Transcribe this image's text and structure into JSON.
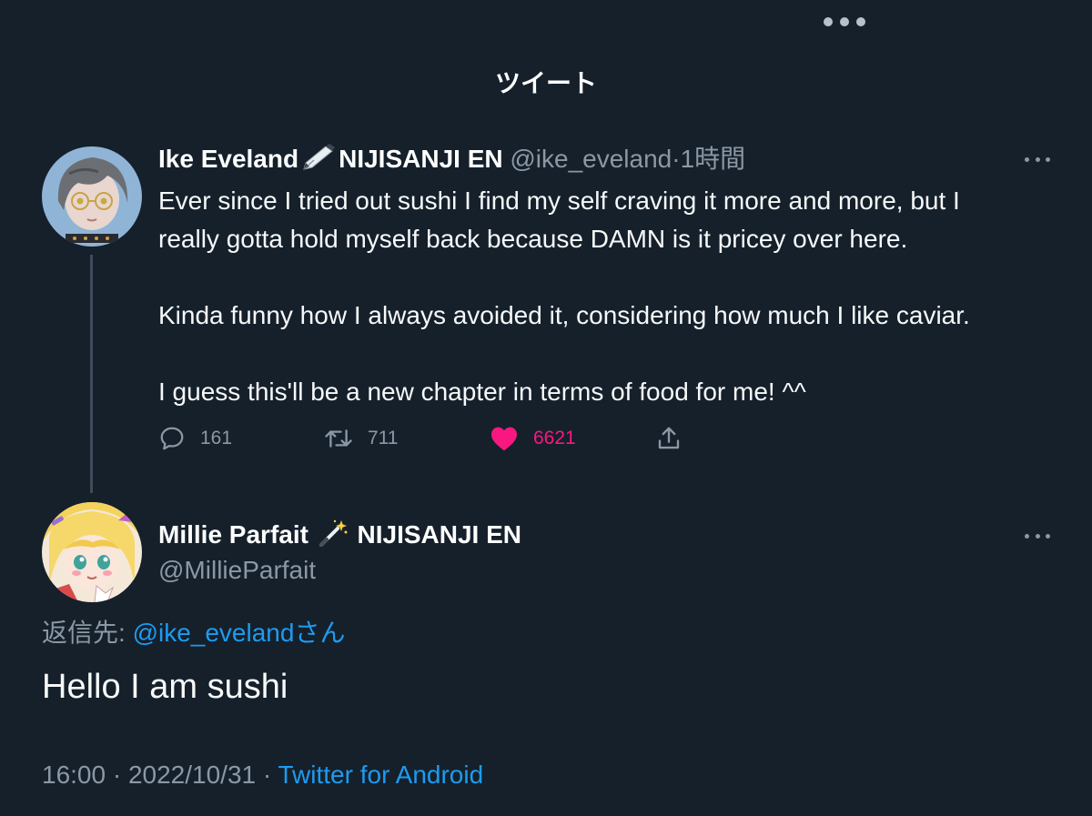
{
  "header": {
    "title": "ツイート"
  },
  "tweet1": {
    "display_name": "Ike Eveland",
    "name_icon": "fountain-pen-icon",
    "name_suffix": "NIJISANJI EN",
    "handle": "@ike_eveland",
    "separator": "·",
    "time": "1時間",
    "body": [
      "Ever since I tried out sushi I find my self craving it more and more, but I",
      "really gotta hold myself back because DAMN is it pricey over here.",
      "Kinda funny how I always avoided it, considering how much I like caviar.",
      "I guess this'll be a new chapter in terms of food for me! ^^"
    ],
    "actions": {
      "replies": "161",
      "retweets": "711",
      "likes": "6621",
      "liked": true
    }
  },
  "tweet2": {
    "display_name": "Millie Parfait",
    "name_icon": "magic-wand-icon",
    "name_suffix": "NIJISANJI EN",
    "handle": "@MillieParfait",
    "reply_prefix": "返信先: ",
    "reply_handle": "@ike_eveland",
    "reply_suffix": "さん",
    "body": "Hello I am sushi",
    "time": "16:00",
    "date": "2022/10/31",
    "dot": "·",
    "client": "Twitter for Android"
  },
  "colors": {
    "background": "#15202b",
    "text": "#f7f9f9",
    "muted": "#8b98a5",
    "link": "#1d9bf0",
    "like": "#f91880",
    "thread_line": "#3f4c59"
  }
}
